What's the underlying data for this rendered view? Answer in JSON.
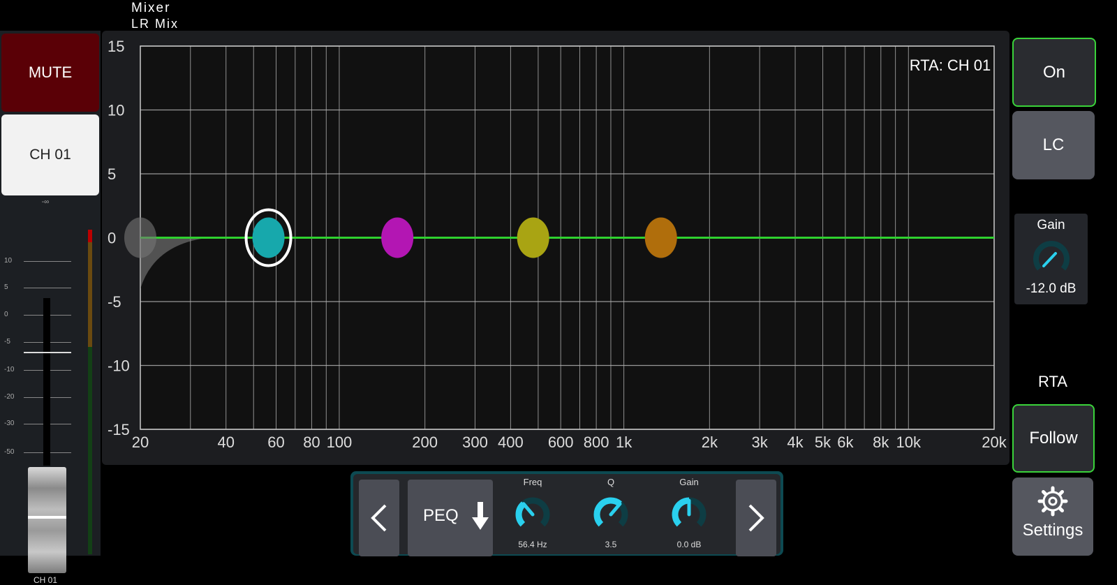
{
  "header": {
    "title": "Mixer",
    "subtitle": "LR Mix"
  },
  "channel": {
    "mute_label": "MUTE",
    "name": "CH 01",
    "level_readout": "-∞",
    "fader_scale": [
      "10",
      "5",
      "0",
      "-5",
      "-10",
      "-20",
      "-30",
      "-50"
    ],
    "footer_name": "CH 01"
  },
  "eq_graph": {
    "rta_label": "RTA: CH 01",
    "y_ticks": [
      "15",
      "10",
      "5",
      "0",
      "-5",
      "-10",
      "-15"
    ],
    "x_ticks": [
      "20",
      "40",
      "60",
      "80",
      "100",
      "200",
      "300",
      "400",
      "600",
      "800",
      "1k",
      "2k",
      "3k",
      "4k",
      "5k",
      "6k",
      "8k",
      "10k",
      "20k"
    ],
    "colors": {
      "curve": "#2fd12f",
      "grid": "#b0b0b0",
      "bg": "#111111"
    },
    "bands": [
      {
        "name": "low-cut",
        "freq": 20,
        "gain": 0,
        "color": "#777777",
        "selected": false
      },
      {
        "name": "band-1",
        "freq": 56.4,
        "gain": 0,
        "color": "#17a8ac",
        "selected": true
      },
      {
        "name": "band-2",
        "freq": 160,
        "gain": 0,
        "color": "#b316b3",
        "selected": false
      },
      {
        "name": "band-3",
        "freq": 480,
        "gain": 0,
        "color": "#a9a413",
        "selected": false
      },
      {
        "name": "band-4",
        "freq": 1350,
        "gain": 0,
        "color": "#b06e0c",
        "selected": false
      }
    ]
  },
  "band_controls": {
    "type_label": "PEQ",
    "freq": {
      "label": "Freq",
      "value": "56.4 Hz",
      "level": 0.35
    },
    "q": {
      "label": "Q",
      "value": "3.5",
      "level": 0.65
    },
    "gain": {
      "label": "Gain",
      "value": "0.0 dB",
      "level": 0.5
    }
  },
  "right_panel": {
    "on_label": "On",
    "lc_label": "LC",
    "gain_label": "Gain",
    "gain_value": "-12.0 dB",
    "rta_label": "RTA",
    "follow_label": "Follow",
    "settings_label": "Settings"
  }
}
